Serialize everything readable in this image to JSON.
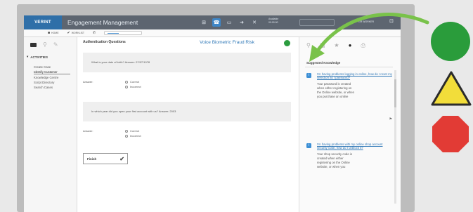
{
  "app": {
    "brand": "VERINT",
    "title": "Engagement Management",
    "agent_info": [
      "Available",
      "00:00:00"
    ],
    "user": "GR WORKER"
  },
  "toolbar2": {
    "items": [
      "HOME",
      "WORKLIST"
    ]
  },
  "sidebar": {
    "section_label": "ACTIVITIES",
    "items": [
      "Create Case",
      "Identify Customer",
      "Knowledge Centre",
      "Script Directory",
      "Search Cases"
    ]
  },
  "center": {
    "header": "Authentication Questions",
    "voice_biometric_label": "Voice Biometric Fraud Risk",
    "voice_biometric_status_color": "#2b9c3f",
    "questions": [
      {
        "text": "What is your date of birth? Answer: 07/07/1978",
        "answer_label": "Answer:",
        "options": [
          "Correct",
          "Incorrect"
        ]
      },
      {
        "text": "In which year did you open your first account with us? Answer: 2003",
        "answer_label": "Answer:",
        "options": [
          "Correct",
          "Incorrect"
        ]
      }
    ],
    "finish_label": "Finish"
  },
  "right": {
    "title": "Suggested Knowledge",
    "articles": [
      {
        "link": "I'm having problems logging in online, how do I reset my selection as I password?",
        "body": [
          "Your password is created",
          "when either registering on",
          "the Online website, or when",
          "you purchase an online"
        ]
      },
      {
        "link": "I'm having problems with my online shop account security code, how do I unblock it?",
        "body": [
          "Your shop security code is",
          "created when either",
          "registering on the Online",
          "website, or when you"
        ]
      }
    ]
  },
  "status_indicators": {
    "colors": [
      "#2a9c3b",
      "#f2dd3a",
      "#e23b35"
    ],
    "icons": [
      "green-circle-icon",
      "yellow-triangle-icon",
      "red-octagon-icon"
    ]
  }
}
